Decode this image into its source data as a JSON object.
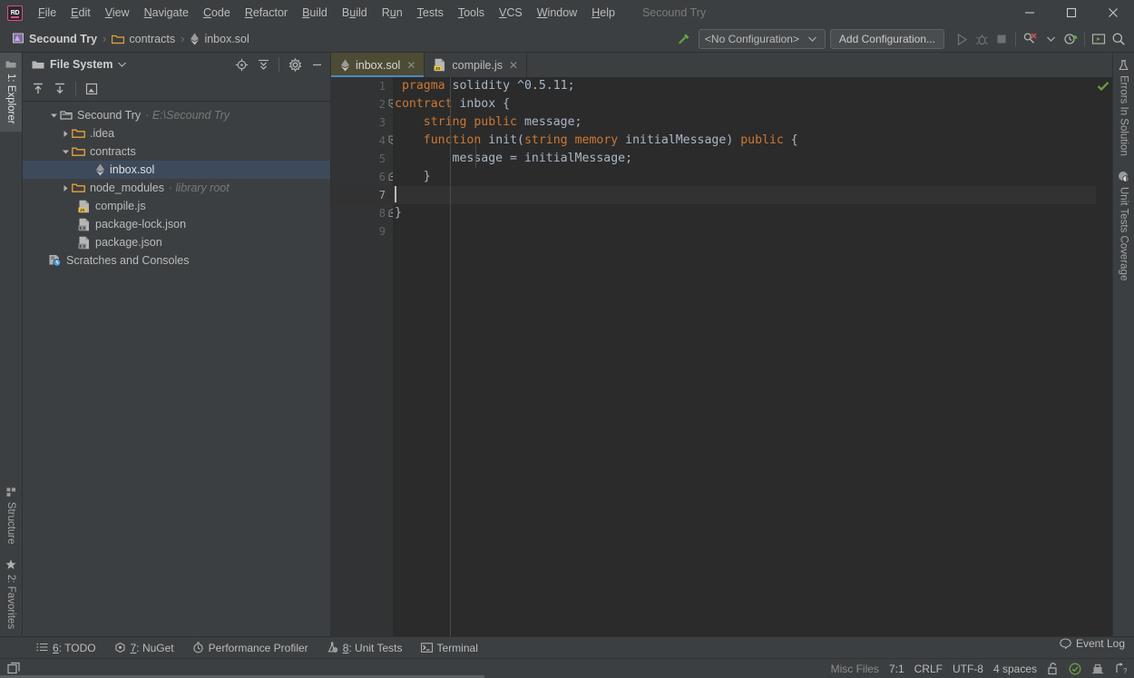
{
  "app": {
    "logo_text": "RD",
    "project_name_title": "Secound Try"
  },
  "menu": {
    "items": [
      {
        "label": "File",
        "mnemonic": "F"
      },
      {
        "label": "Edit",
        "mnemonic": "E"
      },
      {
        "label": "View",
        "mnemonic": "V"
      },
      {
        "label": "Navigate",
        "mnemonic": "N"
      },
      {
        "label": "Code",
        "mnemonic": "C"
      },
      {
        "label": "Refactor",
        "mnemonic": "R"
      },
      {
        "label": "Build",
        "mnemonic": "B"
      },
      {
        "label": "Build",
        "mnemonic": "u"
      },
      {
        "label": "Run",
        "mnemonic": "R"
      },
      {
        "label": "Tests",
        "mnemonic": "T"
      },
      {
        "label": "Tools",
        "mnemonic": "T"
      },
      {
        "label": "VCS",
        "mnemonic": "V"
      },
      {
        "label": "Window",
        "mnemonic": "W"
      },
      {
        "label": "Help",
        "mnemonic": "H"
      }
    ]
  },
  "window_controls": {
    "minimize": "—",
    "maximize": "□",
    "close": "✕"
  },
  "breadcrumb": {
    "items": [
      {
        "label": "Secound Try",
        "icon": "project-icon"
      },
      {
        "label": "contracts",
        "icon": "folder-icon"
      },
      {
        "label": "inbox.sol",
        "icon": "solidity-icon"
      }
    ],
    "separator": "›"
  },
  "toolbar": {
    "build_icon": "hammer-icon",
    "run_config_label": "<No Configuration>",
    "add_config_label": "Add Configuration...",
    "run_icon": "run-play-icon",
    "debug_icon": "debug-bug-icon",
    "stop_icon": "stop-square-icon",
    "inspect_icon": "inspect-magnifier-icon",
    "update_icon": "update-clock-icon",
    "terminal_icon": "terminal-run-icon",
    "search_icon": "search-icon"
  },
  "left_rail": {
    "top": [
      {
        "label": "1: Explorer",
        "icon": "folder-icon",
        "active": true
      }
    ],
    "bottom": [
      {
        "label": "Structure",
        "icon": "structure-icon",
        "active": false
      },
      {
        "label": "2: Favorites",
        "icon": "star-icon",
        "active": false
      }
    ]
  },
  "right_rail": {
    "items": [
      {
        "label": "Errors In Solution",
        "icon": "flask-icon"
      },
      {
        "label": "Unit Tests Coverage",
        "icon": "coverage-icon"
      }
    ]
  },
  "project_panel": {
    "title": "File System",
    "dropdown_icon": "chevron-down-icon",
    "actions": [
      {
        "name": "locate-icon"
      },
      {
        "name": "collapse-all-icon"
      },
      {
        "name": "settings-gear-icon"
      },
      {
        "name": "hide-panel-icon"
      }
    ],
    "toolbar2": [
      {
        "name": "upload-icon"
      },
      {
        "name": "download-icon"
      },
      {
        "name": "compare-icon"
      }
    ],
    "tree": [
      {
        "indent": 0,
        "arrow": "down",
        "icon": "root-folder-icon",
        "label": "Secound Try",
        "hint": "E:\\Secound Try",
        "selected": false
      },
      {
        "indent": 1,
        "arrow": "right",
        "icon": "folder-icon",
        "label": ".idea",
        "hint": "",
        "selected": false
      },
      {
        "indent": 1,
        "arrow": "down",
        "icon": "folder-icon",
        "label": "contracts",
        "hint": "",
        "selected": false
      },
      {
        "indent": 2,
        "arrow": "none",
        "icon": "solidity-icon",
        "label": "inbox.sol",
        "hint": "",
        "selected": true
      },
      {
        "indent": 1,
        "arrow": "right",
        "icon": "folder-icon",
        "label": "node_modules",
        "hint": "library root",
        "selected": false
      },
      {
        "indent": 1,
        "arrow": "none",
        "icon": "js-file-icon",
        "label": "compile.js",
        "hint": "",
        "selected": false
      },
      {
        "indent": 1,
        "arrow": "none",
        "icon": "json-file-icon",
        "label": "package-lock.json",
        "hint": "",
        "selected": false
      },
      {
        "indent": 1,
        "arrow": "none",
        "icon": "json-file-icon",
        "label": "package.json",
        "hint": "",
        "selected": false
      },
      {
        "indent": 0,
        "arrow": "none",
        "icon": "scratches-icon",
        "label": "Scratches and Consoles",
        "hint": "",
        "selected": false
      }
    ]
  },
  "editor": {
    "tabs": [
      {
        "label": "inbox.sol",
        "icon": "solidity-icon",
        "active": true,
        "close": "✕"
      },
      {
        "label": "compile.js",
        "icon": "js-file-icon",
        "active": false,
        "close": "✕"
      }
    ],
    "line_numbers": [
      "1",
      "2",
      "3",
      "4",
      "5",
      "6",
      "7",
      "8",
      "9"
    ],
    "current_line": 7,
    "inspection_status_icon": "green-check-icon",
    "lines": [
      {
        "n": 1,
        "tokens": [
          {
            "t": " ",
            "c": "pun"
          },
          {
            "t": "pragma",
            "c": "kw"
          },
          {
            "t": " ",
            "c": "pun"
          },
          {
            "t": "solidity",
            "c": "id"
          },
          {
            "t": " ^",
            "c": "pun"
          },
          {
            "t": "0.5.11",
            "c": "id"
          },
          {
            "t": ";",
            "c": "pun"
          }
        ]
      },
      {
        "n": 2,
        "tokens": [
          {
            "t": "contract",
            "c": "kw"
          },
          {
            "t": " ",
            "c": "pun"
          },
          {
            "t": "inbox",
            "c": "id"
          },
          {
            "t": " {",
            "c": "pun"
          }
        ]
      },
      {
        "n": 3,
        "tokens": [
          {
            "t": "    ",
            "c": "pun"
          },
          {
            "t": "string",
            "c": "kw"
          },
          {
            "t": " ",
            "c": "pun"
          },
          {
            "t": "public",
            "c": "kw"
          },
          {
            "t": " ",
            "c": "pun"
          },
          {
            "t": "message",
            "c": "id"
          },
          {
            "t": ";",
            "c": "pun"
          }
        ]
      },
      {
        "n": 4,
        "tokens": [
          {
            "t": "    ",
            "c": "pun"
          },
          {
            "t": "function",
            "c": "kw"
          },
          {
            "t": " ",
            "c": "pun"
          },
          {
            "t": "init",
            "c": "id"
          },
          {
            "t": "(",
            "c": "pun"
          },
          {
            "t": "string",
            "c": "kw"
          },
          {
            "t": " ",
            "c": "pun"
          },
          {
            "t": "memory",
            "c": "kw"
          },
          {
            "t": " ",
            "c": "pun"
          },
          {
            "t": "initialMessage",
            "c": "id"
          },
          {
            "t": ") ",
            "c": "pun"
          },
          {
            "t": "public",
            "c": "kw"
          },
          {
            "t": " {",
            "c": "pun"
          }
        ]
      },
      {
        "n": 5,
        "tokens": [
          {
            "t": "        ",
            "c": "pun"
          },
          {
            "t": "message",
            "c": "id"
          },
          {
            "t": " = ",
            "c": "pun"
          },
          {
            "t": "initialMessage",
            "c": "id"
          },
          {
            "t": ";",
            "c": "pun"
          }
        ]
      },
      {
        "n": 6,
        "tokens": [
          {
            "t": "    }",
            "c": "pun"
          }
        ]
      },
      {
        "n": 7,
        "tokens": [
          {
            "t": "",
            "c": "pun"
          }
        ]
      },
      {
        "n": 8,
        "tokens": [
          {
            "t": "}",
            "c": "pun"
          }
        ]
      },
      {
        "n": 9,
        "tokens": [
          {
            "t": "",
            "c": "pun"
          }
        ]
      }
    ],
    "source_text": "pragma solidity ^0.5.11;\ncontract inbox {\n    string public message;\n    function init(string memory initialMessage) public {\n        message = initialMessage;\n    }\n\n}\n"
  },
  "tool_windows": {
    "items": [
      {
        "label": "6: TODO",
        "num": "6",
        "text": ": TODO",
        "icon": "todo-list-icon"
      },
      {
        "label": "7: NuGet",
        "num": "7",
        "text": ": NuGet",
        "icon": "nuget-icon"
      },
      {
        "label": "Performance Profiler",
        "num": "",
        "text": "Performance Profiler",
        "icon": "profiler-icon"
      },
      {
        "label": "8: Unit Tests",
        "num": "8",
        "text": ": Unit Tests",
        "icon": "unit-tests-icon"
      },
      {
        "label": "Terminal",
        "num": "",
        "text": "Terminal",
        "icon": "terminal-icon"
      }
    ]
  },
  "status_bar": {
    "toggle_icon": "toggle-toolwindows-icon",
    "event_log_label": "Event Log",
    "event_log_icon": "event-log-icon",
    "file_type": "Misc Files",
    "caret_position": "7:1",
    "line_separator": "CRLF",
    "encoding": "UTF-8",
    "indent": "4 spaces",
    "lock_icon": "unlock-icon",
    "inspection_icon": "green-check-circle-icon",
    "python_icon": "interpreter-icon",
    "vcs_icon": "branch-question-icon"
  },
  "colors": {
    "chrome_bg": "#3c3f41",
    "editor_bg": "#2b2b2b",
    "gutter_bg": "#313335",
    "accent_blue": "#4a88c7",
    "selection": "#3d4a5c",
    "active_tab": "#4e4b35",
    "keyword": "#cc7832",
    "identifier": "#a9b7c6",
    "folder_orange": "#e8a33d",
    "green_ok": "#6a9b3f"
  }
}
